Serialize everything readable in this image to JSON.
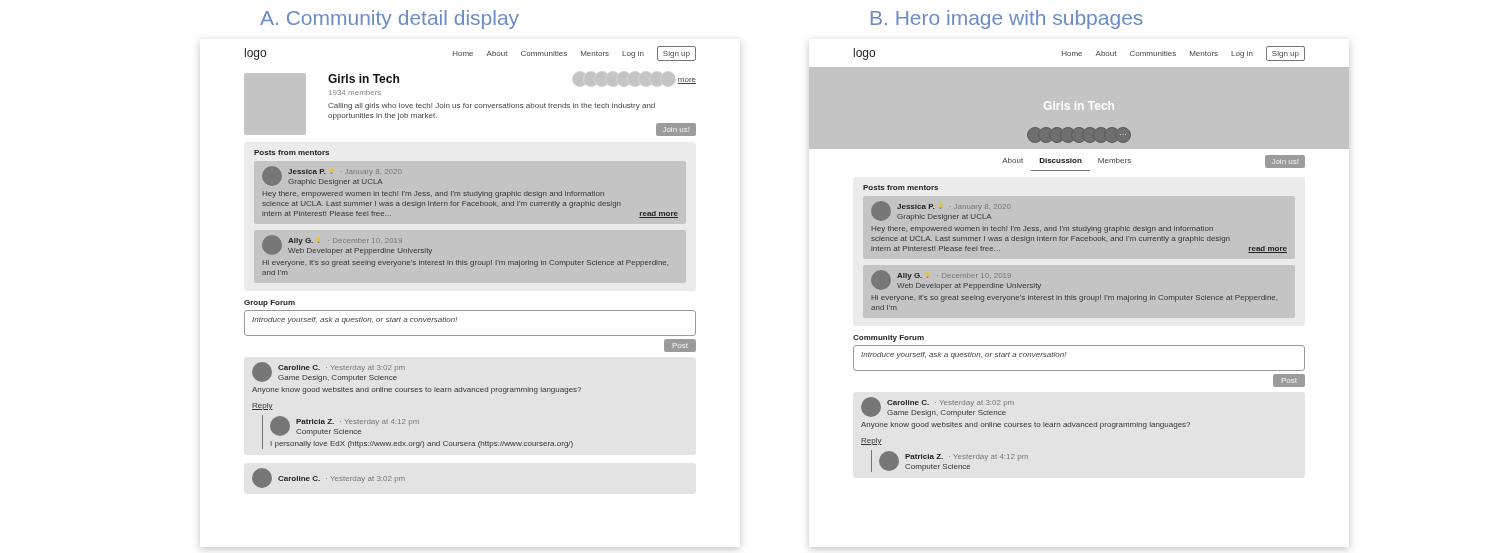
{
  "panels": [
    {
      "heading": "A. Community detail display",
      "kind": "detail",
      "logo": "logo",
      "nav_links": [
        "Home",
        "About",
        "Communities",
        "Mentors",
        "Log in"
      ],
      "signup": "Sign up",
      "community": {
        "name": "Girls in Tech",
        "members": "1934 members",
        "more": "more",
        "description": "Calling all girls who love tech! Join us for conversations about trends in the tech industry and opportunities in the job market.",
        "join": "Join us!"
      },
      "mentors": {
        "title": "Posts from mentors",
        "posts": [
          {
            "name": "Jessica P.",
            "date": "· January 8, 2020",
            "role": "Graphic Designer at UCLA",
            "body": "Hey there, empowered women in tech! I'm Jess, and I'm studying graphic design and information science at UCLA. Last summer I was a design intern for Facebook, and I'm currently a graphic design intern at Pinterest! Please feel free...",
            "read_more": "read more"
          },
          {
            "name": "Ally G.",
            "date": "· December 10, 2019",
            "role": "Web Developer at Pepperdine University",
            "body": "Hi everyone, it's so great seeing everyone's interest in this group! I'm majoring in Computer Science at Pepperdine, and I'm"
          }
        ]
      },
      "forum": {
        "title": "Group Forum",
        "placeholder": "Introduce yourself, ask a question, or start a conversation!",
        "post": "Post"
      },
      "comments": [
        {
          "name": "Caroline C.",
          "time": "· Yesterday at 3:02 pm",
          "role": "Game Design, Computer Science",
          "body": "Anyone know good websites and online courses to learn advanced programming languages?",
          "reply": "Reply",
          "replies": [
            {
              "name": "Patricia Z.",
              "time": "· Yesterday at 4:12 pm",
              "role": "Computer Science",
              "body": "I personally love EdX (https://www.edx.org/) and Coursera (https://www.coursera.org/)"
            }
          ]
        },
        {
          "name": "Caroline C.",
          "time": "· Yesterday at 3:02 pm"
        }
      ]
    },
    {
      "heading": "B. Hero image with subpages",
      "kind": "hero",
      "logo": "logo",
      "nav_links": [
        "Home",
        "About",
        "Communities",
        "Mentors",
        "Log in"
      ],
      "signup": "Sign up",
      "community": {
        "name": "Girls in Tech",
        "overflow_mark": "···",
        "join": "Join us!"
      },
      "tabs": [
        {
          "label": "About",
          "selected": false
        },
        {
          "label": "Discussion",
          "selected": true
        },
        {
          "label": "Members",
          "selected": false
        }
      ],
      "mentors": {
        "title": "Posts from mentors",
        "posts": [
          {
            "name": "Jessica P.",
            "date": "· January 8, 2020",
            "role": "Graphic Designer at UCLA",
            "body": "Hey there, empowered women in tech! I'm Jess, and I'm studying graphic design and information science at UCLA. Last summer I was a design intern for Facebook, and I'm currently a graphic design intern at Pinterest! Please feel free...",
            "read_more": "read more"
          },
          {
            "name": "Ally G.",
            "date": "· December 10, 2019",
            "role": "Web Developer at Pepperdine University",
            "body": "Hi everyone, it's so great seeing everyone's interest in this group! I'm majoring in Computer Science at Pepperdine, and I'm"
          }
        ]
      },
      "forum": {
        "title": "Community Forum",
        "placeholder": "Introduce yourself, ask a question, or start a conversation!",
        "post": "Post"
      },
      "comments": [
        {
          "name": "Caroline C.",
          "time": "· Yesterday at 3:02 pm",
          "role": "Game Design, Computer Science",
          "body": "Anyone know good websites and online courses to learn advanced programming languages?",
          "reply": "Reply",
          "replies": [
            {
              "name": "Patricia Z.",
              "time": "· Yesterday at 4:12 pm",
              "role": "Computer Science"
            }
          ]
        }
      ]
    }
  ]
}
